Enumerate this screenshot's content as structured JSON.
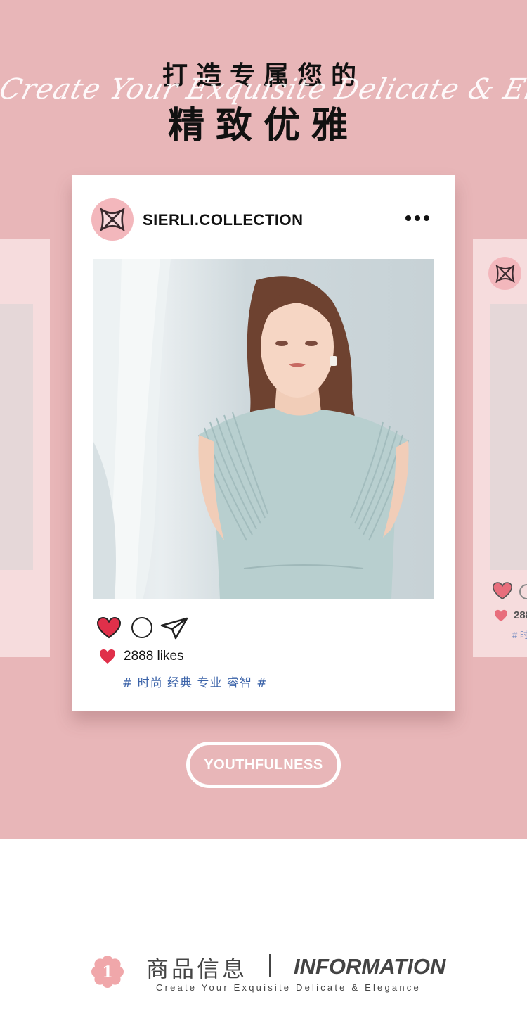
{
  "header": {
    "title_line1": "打造专属您的",
    "script_text": "Create Your Exquisite Delicate & Elegance",
    "title_line2": "精致优雅"
  },
  "post": {
    "account": "SIERLI.COLLECTION",
    "likes": "2888 likes",
    "tags": "# 时尚 经典 专业 睿智 #"
  },
  "side_card_right": {
    "likes_partial": "288",
    "tags_partial": "# 时"
  },
  "cta": {
    "label": "YOUTHFULNESS"
  },
  "section": {
    "number": "1",
    "title_cn": "商品信息",
    "title_en": "INFORMATION",
    "subtitle": "Create Your Exquisite Delicate & Elegance"
  },
  "icons": {
    "more": "more-dots-icon",
    "like": "heart-icon",
    "comment": "comment-icon",
    "share": "send-icon"
  },
  "colors": {
    "background_pink": "#e8b6b8",
    "side_card_pink": "#f6dcdd",
    "logo_pink": "#f3b7bc",
    "heart_red": "#e0304a",
    "tag_blue": "#3a62a8"
  }
}
